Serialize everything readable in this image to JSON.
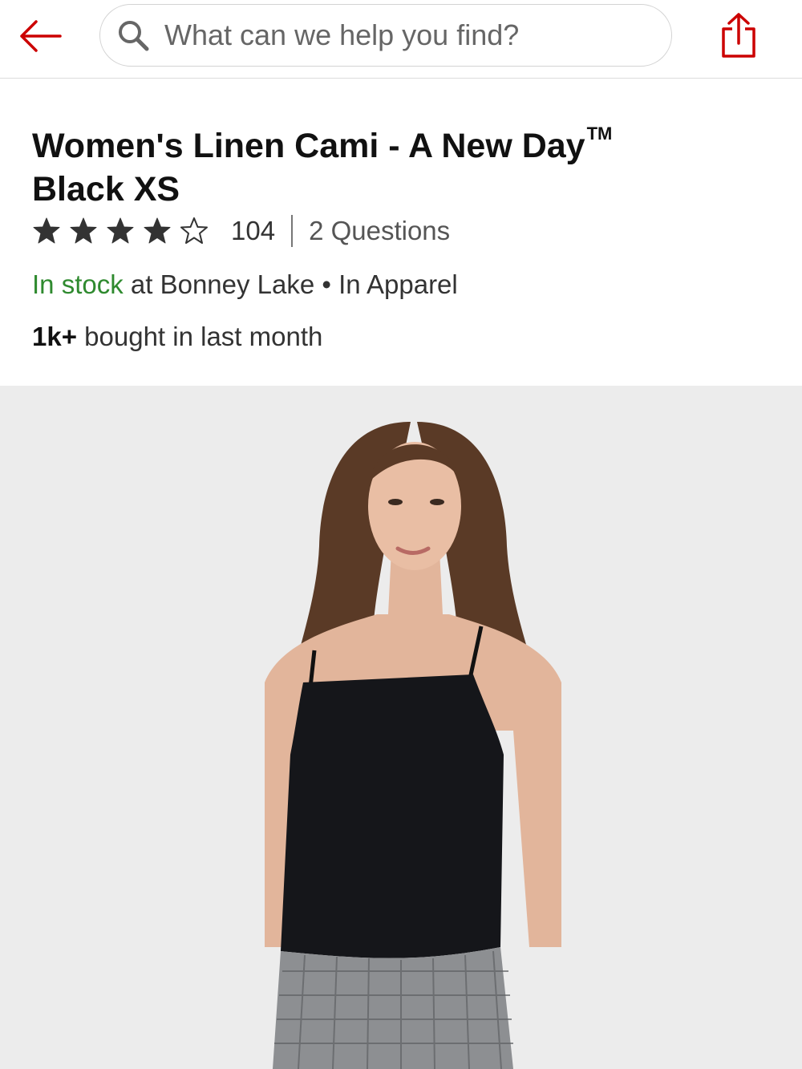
{
  "header": {
    "search_placeholder": "What can we help you find?",
    "accent_color": "#cc0000"
  },
  "product": {
    "title_line1": "Women's Linen Cami - A New Day",
    "trademark": "TM",
    "title_line2": "Black XS",
    "rating": 4,
    "rating_max": 5,
    "review_count": "104",
    "questions": "2 Questions",
    "stock_status": "In stock",
    "stock_location": " at Bonney Lake",
    "bullet": " • ",
    "department": "In Apparel",
    "bought_count": "1k+",
    "bought_text": " bought in last month"
  },
  "icons": {
    "back": "arrow-left-icon",
    "search": "search-icon",
    "share": "share-icon",
    "star_filled": "star-filled-icon",
    "star_empty": "star-outline-icon"
  },
  "image": {
    "background_color": "#ececec"
  }
}
